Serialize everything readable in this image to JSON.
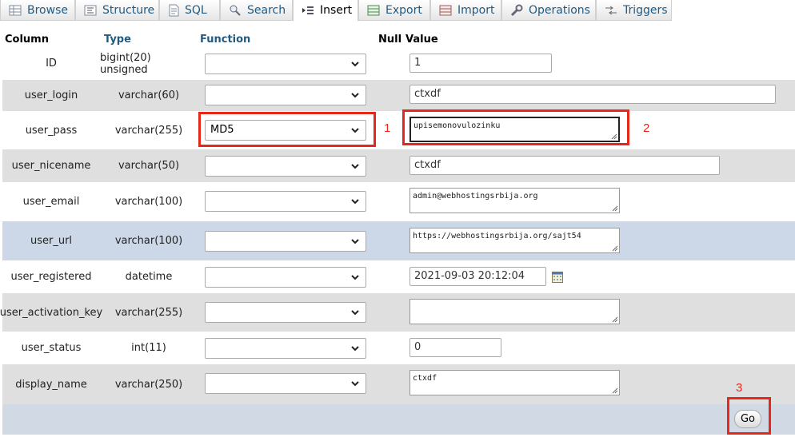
{
  "tabs": [
    {
      "label": "Browse",
      "icon": "browse-icon"
    },
    {
      "label": "Structure",
      "icon": "structure-icon"
    },
    {
      "label": "SQL",
      "icon": "sql-icon"
    },
    {
      "label": "Search",
      "icon": "search-icon"
    },
    {
      "label": "Insert",
      "icon": "insert-icon",
      "active": true
    },
    {
      "label": "Export",
      "icon": "export-icon"
    },
    {
      "label": "Import",
      "icon": "import-icon"
    },
    {
      "label": "Operations",
      "icon": "wrench-icon"
    },
    {
      "label": "Triggers",
      "icon": "triggers-icon"
    }
  ],
  "table_header": {
    "column": "Column",
    "type": "Type",
    "function": "Function",
    "null": "Null",
    "value": "Value"
  },
  "rows": [
    {
      "column": "ID",
      "type": "bigint(20) unsigned",
      "function": "",
      "value": "1",
      "widget": "input"
    },
    {
      "column": "user_login",
      "type": "varchar(60)",
      "function": "",
      "value": "ctxdf",
      "widget": "input"
    },
    {
      "column": "user_pass",
      "type": "varchar(255)",
      "function": "MD5",
      "value": "upisemonovulozinku",
      "widget": "textarea"
    },
    {
      "column": "user_nicename",
      "type": "varchar(50)",
      "function": "",
      "value": "ctxdf",
      "widget": "input"
    },
    {
      "column": "user_email",
      "type": "varchar(100)",
      "function": "",
      "value": "admin@webhostingsrbija.org",
      "widget": "textarea"
    },
    {
      "column": "user_url",
      "type": "varchar(100)",
      "function": "",
      "value": "https://webhostingsrbija.org/sajt54",
      "widget": "textarea"
    },
    {
      "column": "user_registered",
      "type": "datetime",
      "function": "",
      "value": "2021-09-03 20:12:04",
      "widget": "input"
    },
    {
      "column": "user_activation_key",
      "type": "varchar(255)",
      "function": "",
      "value": "",
      "widget": "textarea"
    },
    {
      "column": "user_status",
      "type": "int(11)",
      "function": "",
      "value": "0",
      "widget": "input"
    },
    {
      "column": "display_name",
      "type": "varchar(250)",
      "function": "",
      "value": "ctxdf",
      "widget": "textarea"
    }
  ],
  "annotations": [
    "1",
    "2",
    "3"
  ],
  "go_button": "Go",
  "colors": {
    "link": "#235a81",
    "annotation": "#e8271b",
    "row_alt": "#dfdfdf",
    "row_highlight": "#ccd8e8",
    "footer": "#d1d9e4"
  }
}
